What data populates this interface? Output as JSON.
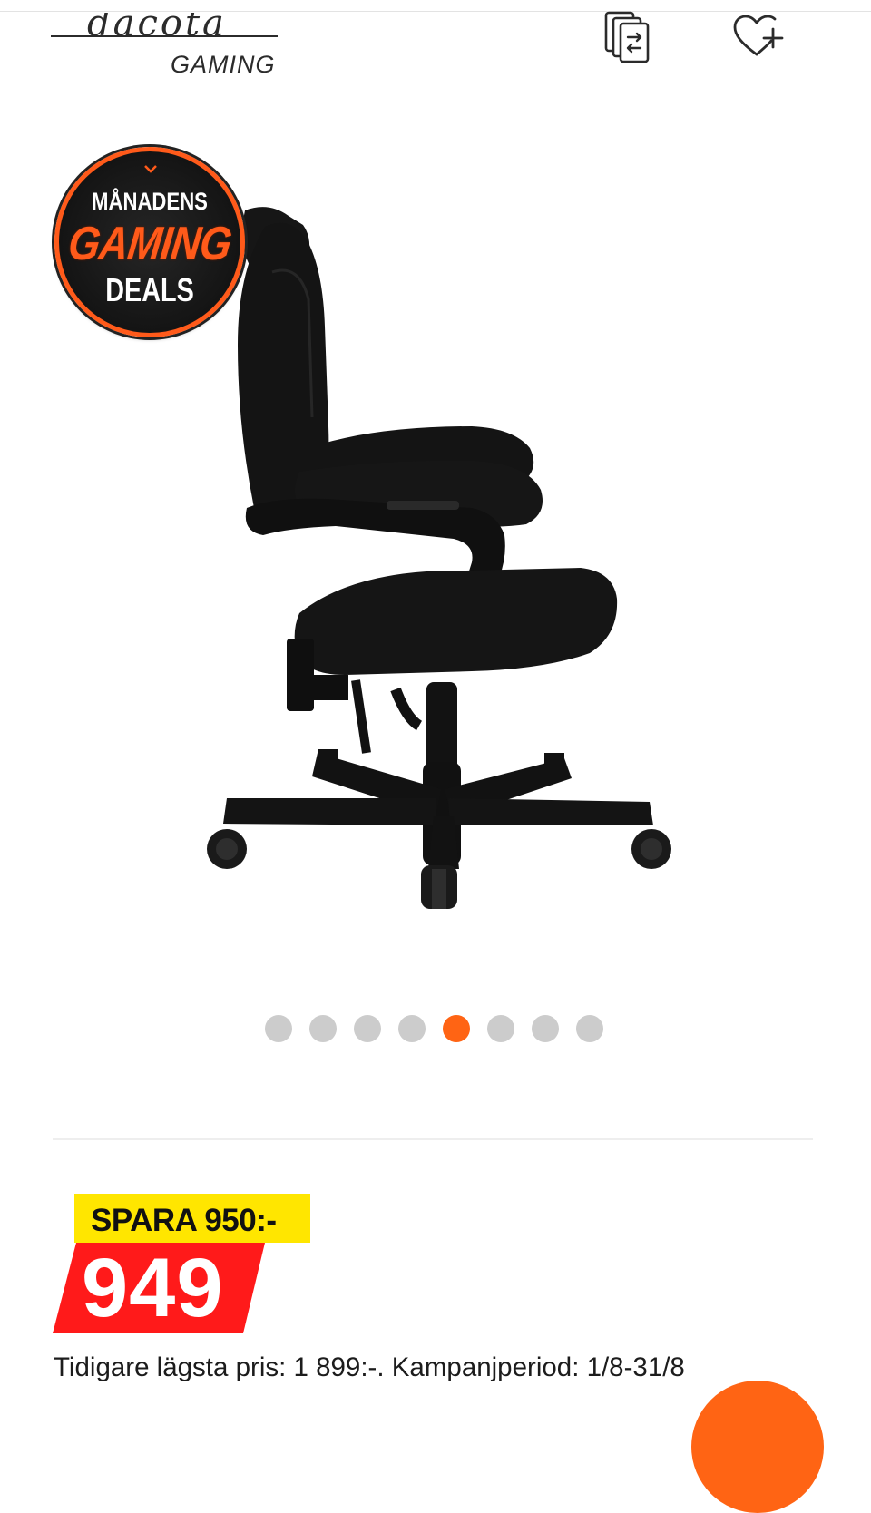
{
  "brand": {
    "wordmark": "dacota",
    "subline": "GAMING"
  },
  "header": {
    "compare_icon": "compare-icon",
    "wishlist_icon": "heart-plus-icon"
  },
  "promo": {
    "line1": "MÅNADENS",
    "line2": "GAMING",
    "line3": "DEALS",
    "accent": "#ff5a1a"
  },
  "gallery": {
    "slide_count": 8,
    "active_index": 4,
    "active_color": "#ff6414",
    "inactive_color": "#cccccc"
  },
  "pricing": {
    "save_label": "SPARA 950:-",
    "price": "949",
    "info": "Tidigare lägsta pris: 1 899:-. Kampanjperiod: 1/8-31/8",
    "save_color": "#ffe600",
    "price_color": "#ff1a1a"
  }
}
